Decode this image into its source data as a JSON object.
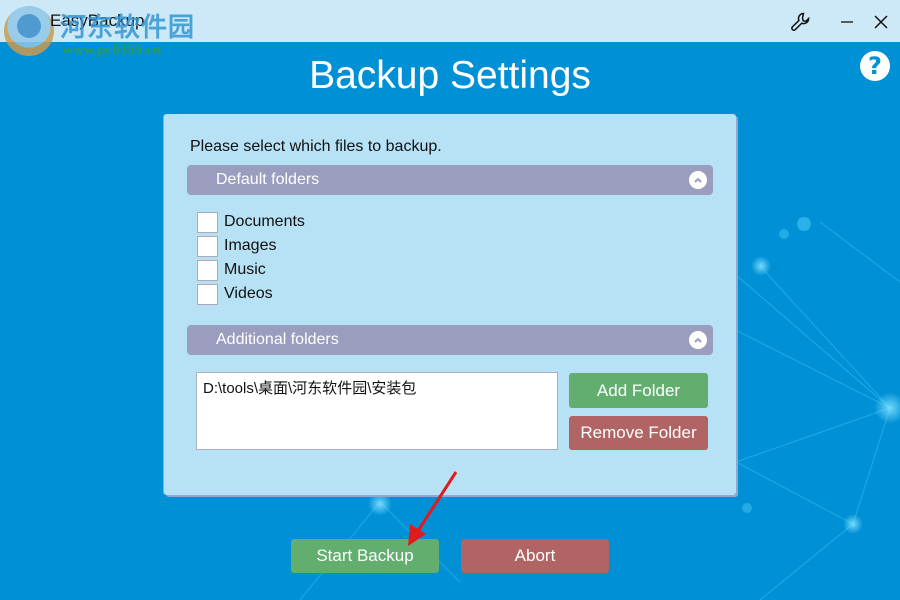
{
  "window": {
    "app_title": "EasyBackup",
    "watermark_text": "河东软件园",
    "watermark_url": "www.pc0359.cn",
    "buttons": {
      "settings_icon": "wrench-icon",
      "minimize_icon": "minimize-icon",
      "close_icon": "close-icon"
    }
  },
  "header": {
    "title": "Backup Settings",
    "help_label": "?"
  },
  "panel": {
    "prompt": "Please select which files to backup.",
    "default_section": {
      "label": "Default folders",
      "items": [
        {
          "label": "Documents",
          "checked": false
        },
        {
          "label": "Images",
          "checked": false
        },
        {
          "label": "Music",
          "checked": false
        },
        {
          "label": "Videos",
          "checked": false
        }
      ]
    },
    "additional_section": {
      "label": "Additional folders",
      "folders": [
        "D:\\tools\\桌面\\河东软件园\\安装包"
      ],
      "add_label": "Add Folder",
      "remove_label": "Remove Folder"
    }
  },
  "footer": {
    "start_label": "Start Backup",
    "abort_label": "Abort"
  },
  "colors": {
    "background": "#0090d6",
    "panel": "#bee4f5",
    "section_header": "#9b9dbf",
    "green_button": "#62ae6f",
    "red_button": "#b16464",
    "annotation_arrow": "#e01b1b"
  }
}
